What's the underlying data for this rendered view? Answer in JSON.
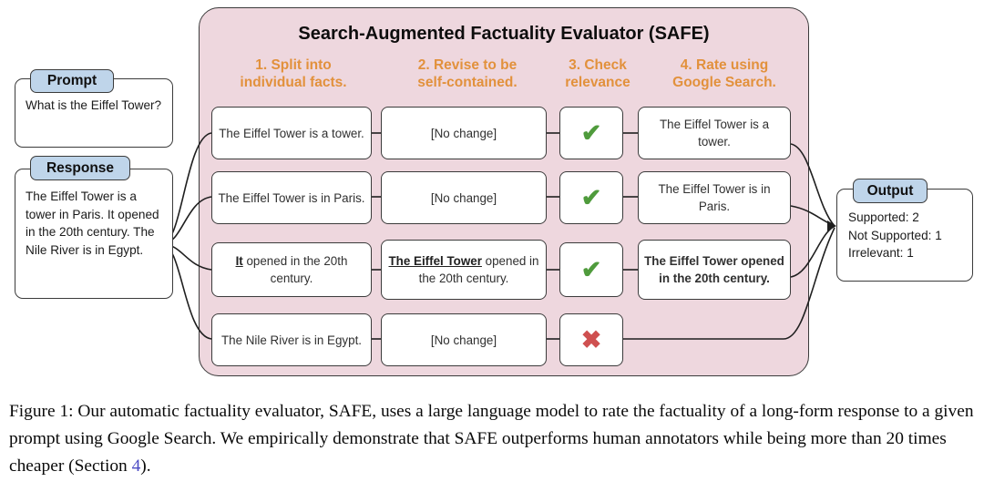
{
  "figure": {
    "panel_title": "Search-Augmented Factuality Evaluator (SAFE)",
    "colors": {
      "panel_bg": "#eed7de",
      "badge_blue": "#bfd5ea",
      "step_orange": "#e2913c",
      "supported_green": "#6fa94f",
      "not_supported_red": "#d9625f",
      "check_green": "#4f9b3c",
      "cross_red": "#cf5050",
      "border": "#3b3b3b",
      "placeholder_gray": "#a9a9a9"
    }
  },
  "prompt": {
    "badge": "Prompt",
    "text": "What is the Eiffel Tower?"
  },
  "response": {
    "badge": "Response",
    "text": "The Eiffel Tower is a tower in Paris. It opened in the 20th century. The Nile River is in Egypt."
  },
  "steps": [
    {
      "number": "1.",
      "line1": "1. Split into",
      "line2": "individual facts."
    },
    {
      "number": "2.",
      "line1": "2. Revise to be",
      "line2": "self-contained."
    },
    {
      "number": "3.",
      "line1": "3. Check",
      "line2": "relevance"
    },
    {
      "number": "4.",
      "line1": "4. Rate using",
      "line2": "Google Search."
    }
  ],
  "rows": [
    {
      "fact": "The Eiffel Tower is a tower.",
      "fact_underlined": "",
      "revised": "[No change]",
      "revised_is_placeholder": true,
      "revised_underlined": "",
      "relevance_icon": "check-icon",
      "relevance_symbol": "✔",
      "rating": "The Eiffel Tower is a tower.",
      "rating_label": "Supported"
    },
    {
      "fact": "The Eiffel Tower is in Paris.",
      "fact_underlined": "",
      "revised": "[No change]",
      "revised_is_placeholder": true,
      "revised_underlined": "",
      "relevance_icon": "check-icon",
      "relevance_symbol": "✔",
      "rating": "The Eiffel Tower is in Paris.",
      "rating_label": "Supported"
    },
    {
      "fact": "It opened in the 20th century.",
      "fact_underlined": "It",
      "fact_rest": " opened in the 20th century.",
      "revised": "The Eiffel Tower opened in the 20th century.",
      "revised_is_placeholder": false,
      "revised_underlined": "The Eiffel Tower",
      "revised_rest": " opened in the 20th century.",
      "relevance_icon": "check-icon",
      "relevance_symbol": "✔",
      "rating": "The Eiffel Tower opened in the 20th century.",
      "rating_label": "Not Supported"
    },
    {
      "fact": "The Nile River is in Egypt.",
      "fact_underlined": "",
      "revised": "[No change]",
      "revised_is_placeholder": true,
      "revised_underlined": "",
      "relevance_icon": "cross-icon",
      "relevance_symbol": "✖",
      "rating": "",
      "rating_label": "Irrelevant"
    }
  ],
  "output": {
    "badge": "Output",
    "lines": [
      "Supported: 2",
      "Not Supported: 1",
      "Irrelevant: 1"
    ]
  },
  "caption": {
    "part1": "Figure 1: Our automatic factuality evaluator, SAFE, uses a large language model to rate the factuality of a long-form response to a given prompt using Google Search. We empirically demonstrate that SAFE outperforms human annotators while being more than 20 times cheaper (Section ",
    "ref": "4",
    "part2": ")."
  }
}
